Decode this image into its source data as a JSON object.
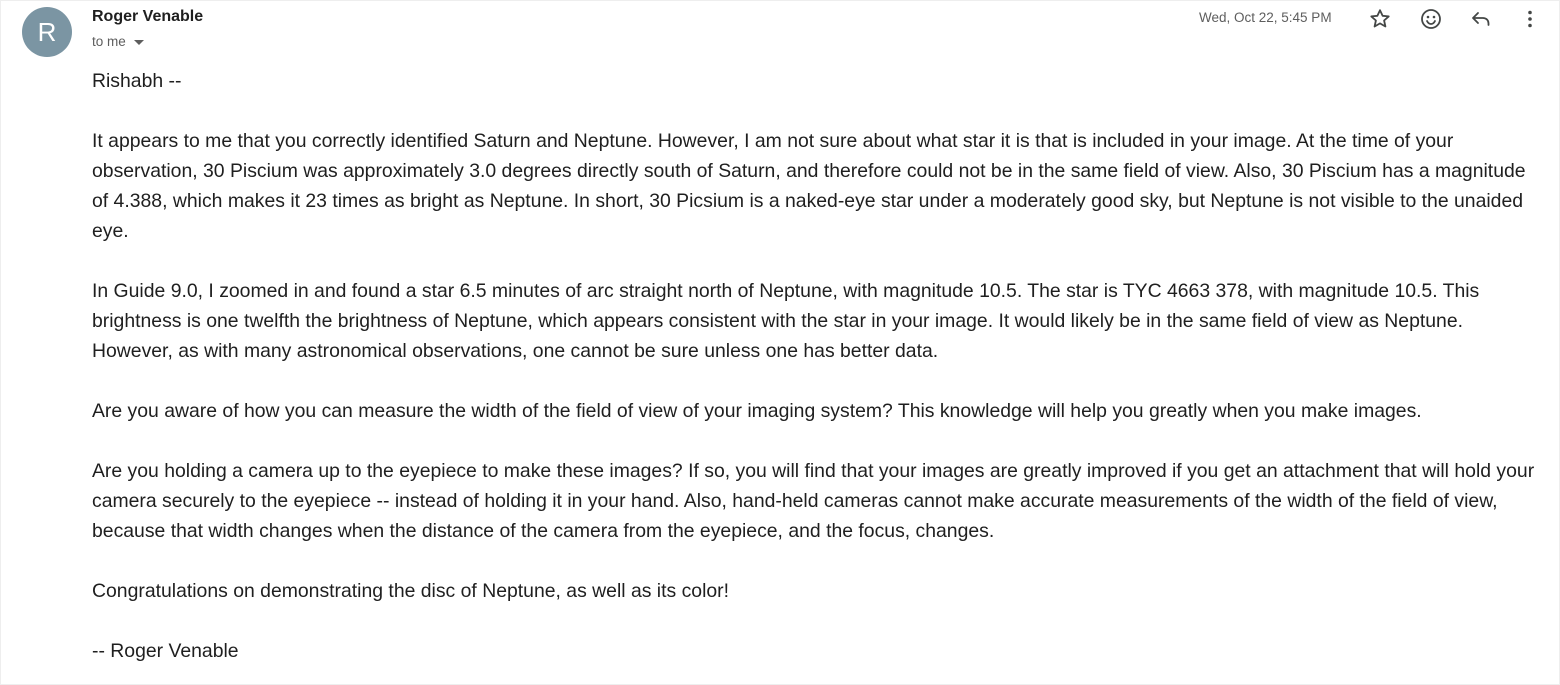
{
  "header": {
    "avatar_initial": "R",
    "sender_name": "Roger Venable",
    "recipient_label": "to me",
    "timestamp": "Wed, Oct 22, 5:45 PM",
    "actions": {
      "star_icon": "star-outline-icon",
      "emoji_icon": "emoji-react-icon",
      "reply_icon": "reply-icon",
      "more_icon": "more-vertical-icon"
    }
  },
  "message": {
    "paragraphs": [
      "Rishabh --",
      "It appears to me that you correctly identified Saturn and Neptune. However, I am not sure about what star it is that is included in your image. At the time of your observation, 30 Piscium was approximately 3.0 degrees directly south of Saturn, and therefore could not be in the same field of view. Also, 30 Piscium has a magnitude of 4.388, which makes it 23 times as bright as Neptune. In short, 30 Picsium is a naked-eye star under a moderately good sky, but Neptune is not visible to the unaided eye.",
      "In Guide 9.0, I zoomed in and found a star 6.5 minutes of arc straight north of Neptune, with magnitude 10.5. The star is TYC 4663 378, with magnitude 10.5. This brightness is one twelfth the brightness of Neptune, which appears consistent with the star in your image. It would likely be in the same field of view as Neptune. However, as with many astronomical observations, one cannot be sure unless one has better data.",
      "Are you aware of how you can measure the width of the field of view of your imaging system? This knowledge will help you greatly when you make images.",
      "Are you holding a camera up to the eyepiece to make these images? If so, you will find that your images are greatly improved if you get an attachment that will hold your camera securely to the eyepiece -- instead of holding it in your hand. Also, hand-held cameras cannot make accurate measurements of the width of the field of view, because that width changes when the distance of the camera from the eyepiece, and the focus, changes.",
      "Congratulations on demonstrating the disc of Neptune, as well as its color!",
      "-- Roger Venable"
    ]
  },
  "colors": {
    "avatar_bg": "#7b95a3",
    "text_primary": "#1f1f1f",
    "text_secondary": "#5e5e5e",
    "icon": "#444746"
  }
}
